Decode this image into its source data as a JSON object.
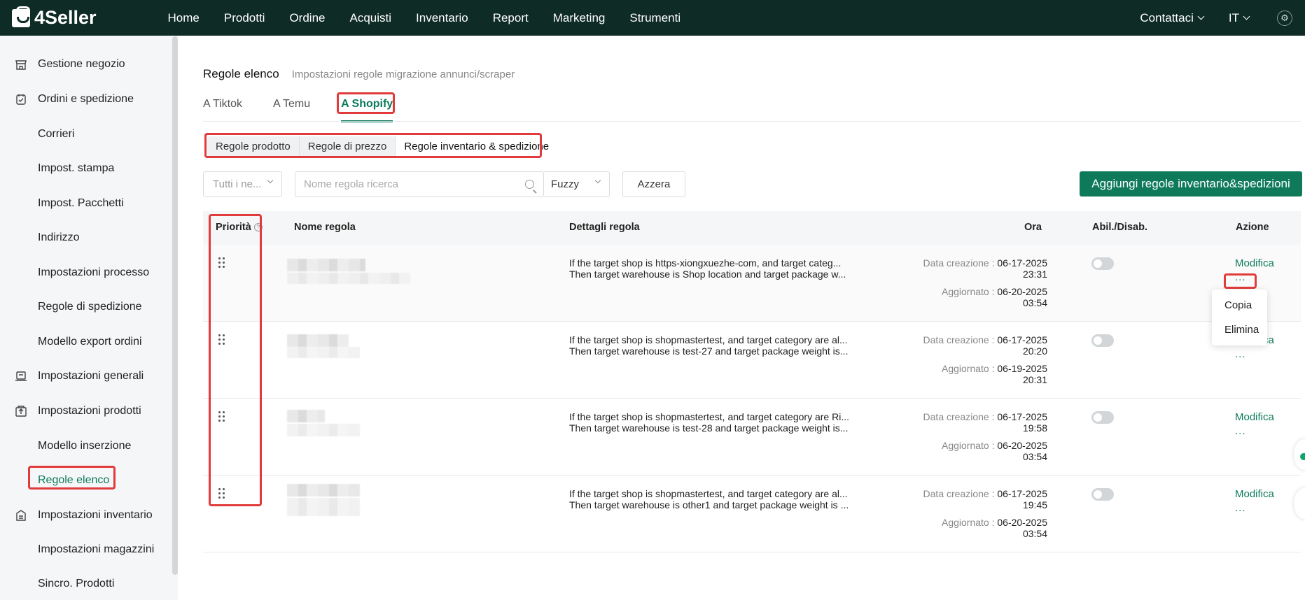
{
  "app": {
    "brand": "4Seller"
  },
  "nav": {
    "items": [
      "Home",
      "Prodotti",
      "Ordine",
      "Acquisti",
      "Inventario",
      "Report",
      "Marketing",
      "Strumenti"
    ],
    "contact": "Contattaci",
    "lang": "IT"
  },
  "sidebar": {
    "items": [
      {
        "label": "Gestione negozio",
        "type": "group",
        "icon": "store-icon"
      },
      {
        "label": "Ordini e spedizione",
        "type": "group",
        "icon": "order-icon"
      },
      {
        "label": "Corrieri",
        "type": "sub"
      },
      {
        "label": "Impost. stampa",
        "type": "sub"
      },
      {
        "label": "Impost. Pacchetti",
        "type": "sub"
      },
      {
        "label": "Indirizzo",
        "type": "sub"
      },
      {
        "label": "Impostazioni processo",
        "type": "sub"
      },
      {
        "label": "Regole di spedizione",
        "type": "sub"
      },
      {
        "label": "Modello export ordini",
        "type": "sub"
      },
      {
        "label": "Impostazioni generali",
        "type": "group",
        "icon": "settings-icon"
      },
      {
        "label": "Impostazioni prodotti",
        "type": "group",
        "icon": "product-icon"
      },
      {
        "label": "Modello inserzione",
        "type": "sub"
      },
      {
        "label": "Regole elenco",
        "type": "sub",
        "active": true
      },
      {
        "label": "Impostazioni inventario",
        "type": "group",
        "icon": "inventory-icon"
      },
      {
        "label": "Impostazioni magazzini",
        "type": "sub"
      },
      {
        "label": "Sincro. Prodotti",
        "type": "sub"
      }
    ]
  },
  "page": {
    "title": "Regole elenco",
    "subtitle": "Impostazioni regole migrazione annunci/scraper",
    "tabs": [
      "A Tiktok",
      "A Temu",
      "A Shopify"
    ],
    "active_tab": "A Shopify",
    "segments": [
      "Regole prodotto",
      "Regole di prezzo",
      "Regole inventario & spedizione"
    ],
    "active_segment": "Regole inventario & spedizione"
  },
  "filters": {
    "shop_placeholder": "Tutti i ne...",
    "search_placeholder": "Nome regola ricerca",
    "match_mode": "Fuzzy",
    "reset_label": "Azzera",
    "add_label": "Aggiungi regole inventario&spedizioni"
  },
  "table": {
    "headers": {
      "priority": "Priorità",
      "name": "Nome regola",
      "details": "Dettagli regola",
      "time": "Ora",
      "toggle": "Abil./Disab.",
      "action": "Azione"
    },
    "rows": [
      {
        "detail_line1": "If the target shop is https-xiongxuezhe-com, and target categ...",
        "detail_line2": "Then target warehouse is Shop location and target package w...",
        "created_label": "Data creazione :",
        "created_date": "06-17-2025",
        "created_time": "23:31",
        "updated_label": "Aggiornato :",
        "updated_date": "06-20-2025",
        "updated_time": "03:54",
        "enabled": false,
        "edit": "Modifica",
        "more": "..."
      },
      {
        "detail_line1": "If the target shop is shopmastertest, and target category are al...",
        "detail_line2": "Then target warehouse is test-27 and target package weight is...",
        "created_label": "Data creazione :",
        "created_date": "06-17-2025",
        "created_time": "20:20",
        "updated_label": "Aggiornato :",
        "updated_date": "06-19-2025",
        "updated_time": "20:31",
        "enabled": false,
        "edit": "Modifica",
        "more": "..."
      },
      {
        "detail_line1": "If the target shop is shopmastertest, and target category are Ri...",
        "detail_line2": "Then target warehouse is test-28 and target package weight is...",
        "created_label": "Data creazione :",
        "created_date": "06-17-2025",
        "created_time": "19:58",
        "updated_label": "Aggiornato :",
        "updated_date": "06-20-2025",
        "updated_time": "03:54",
        "enabled": false,
        "edit": "Modifica",
        "more": "..."
      },
      {
        "detail_line1": "If the target shop is shopmastertest, and target category are al...",
        "detail_line2": "Then target warehouse is other1 and target package weight is ...",
        "created_label": "Data creazione :",
        "created_date": "06-17-2025",
        "created_time": "19:45",
        "updated_label": "Aggiornato :",
        "updated_date": "06-20-2025",
        "updated_time": "03:54",
        "enabled": false,
        "edit": "Modifica",
        "more": "..."
      }
    ]
  },
  "popover": {
    "items": [
      "Copia",
      "Elimina"
    ]
  },
  "colors": {
    "topbar": "#0e2b25",
    "accent": "#0b7a5c",
    "highlight": "#e23b3b"
  }
}
